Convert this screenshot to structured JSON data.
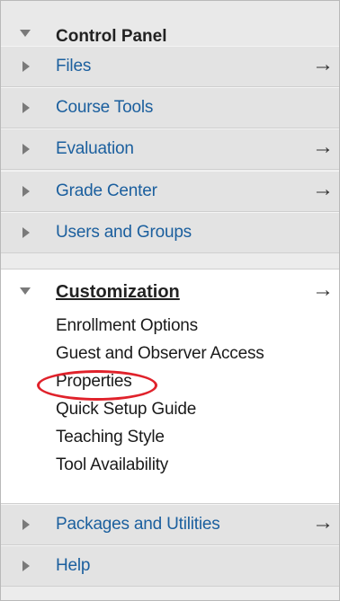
{
  "control_panel": {
    "title": "Control Panel"
  },
  "menu": {
    "files": {
      "label": "Files",
      "arrow": "→"
    },
    "course_tools": {
      "label": "Course Tools"
    },
    "evaluation": {
      "label": "Evaluation",
      "arrow": "→"
    },
    "grade_center": {
      "label": "Grade Center",
      "arrow": "→"
    },
    "users_groups": {
      "label": "Users and Groups"
    },
    "customization": {
      "label": "Customization",
      "arrow": "→",
      "items": [
        "Enrollment Options",
        "Guest and Observer Access",
        "Properties",
        "Quick Setup Guide",
        "Teaching Style",
        "Tool Availability"
      ]
    },
    "packages": {
      "label": "Packages and Utilities",
      "arrow": "→"
    },
    "help": {
      "label": "Help"
    }
  },
  "colors": {
    "link_blue": "#1b5f9e",
    "highlight_red": "#e0222b"
  },
  "icons": {
    "collapsed": "caret-right-icon",
    "expanded": "caret-down-icon",
    "arrow": "right-arrow-icon"
  }
}
